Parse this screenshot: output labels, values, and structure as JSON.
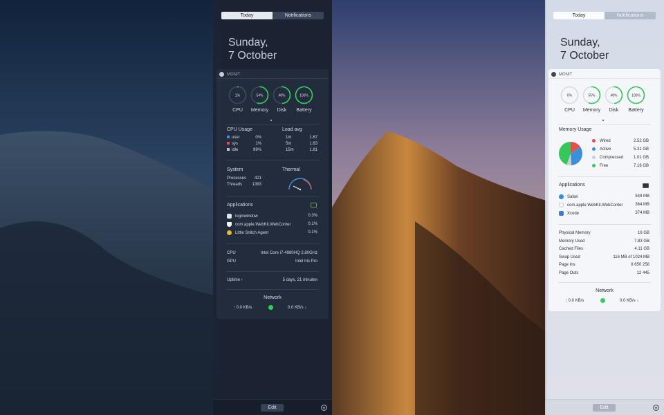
{
  "dark": {
    "tabs": {
      "today": "Today",
      "notifications": "Notifications"
    },
    "date": {
      "line1": "Sunday,",
      "line2": "7 October"
    },
    "widget_title": "MONIT",
    "gauges": [
      {
        "label": "CPU",
        "value": "1%",
        "fraction": 0.01
      },
      {
        "label": "Memory",
        "value": "54%",
        "fraction": 0.54
      },
      {
        "label": "Disk",
        "value": "48%",
        "fraction": 0.48
      },
      {
        "label": "Battery",
        "value": "100%",
        "fraction": 1.0
      }
    ],
    "cpu_usage": {
      "title": "CPU Usage",
      "rows": [
        {
          "label": "user",
          "value": "0%",
          "color": "#3b8fd9"
        },
        {
          "label": "sys",
          "value": "1%",
          "color": "#e2514a"
        },
        {
          "label": "idle",
          "value": "99%",
          "color": "#b9c0cc"
        }
      ]
    },
    "load_avg": {
      "title": "Load avg",
      "rows": [
        {
          "label": "1m",
          "value": "1.67"
        },
        {
          "label": "5m",
          "value": "1.63"
        },
        {
          "label": "15m",
          "value": "1.81"
        }
      ]
    },
    "system": {
      "title": "System",
      "rows": [
        {
          "label": "Processes",
          "value": "421"
        },
        {
          "label": "Threads",
          "value": "1393"
        }
      ]
    },
    "thermal": {
      "title": "Thermal"
    },
    "applications": {
      "title": "Applications",
      "rows": [
        {
          "name": "loginwindow",
          "value": "0.3%",
          "icon": "document-icon"
        },
        {
          "name": "com.apple.WebKit.WebConter",
          "value": "0.1%",
          "icon": "shield-icon"
        },
        {
          "name": "Little Snitch Agent",
          "value": "0.1%",
          "icon": "snitch-icon"
        }
      ]
    },
    "hardware": {
      "rows": [
        {
          "label": "CPU",
          "value": "Intel Core i7-4980HQ 2.80GHz"
        },
        {
          "label": "GPU",
          "value": "Intel Iris Pro"
        }
      ]
    },
    "uptime": {
      "label": "Uptime ›",
      "value": "5 days, 21 minutes"
    },
    "network": {
      "title": "Network",
      "up": "↑ 0.0 KB/s",
      "down": "0.0 KB/s ↓"
    },
    "edit": "Edit"
  },
  "light": {
    "tabs": {
      "today": "Today",
      "notifications": "Notifications"
    },
    "date": {
      "line1": "Sunday,",
      "line2": "7 October"
    },
    "widget_title": "MONIT",
    "gauges": [
      {
        "label": "CPU",
        "value": "0%",
        "fraction": 0.0
      },
      {
        "label": "Memory",
        "value": "55%",
        "fraction": 0.55
      },
      {
        "label": "Disk",
        "value": "48%",
        "fraction": 0.48
      },
      {
        "label": "Battery",
        "value": "100%",
        "fraction": 1.0
      }
    ],
    "memory_usage": {
      "title": "Memory Usage",
      "rows": [
        {
          "label": "Wired",
          "value": "2.52 GB",
          "color": "#e2514a"
        },
        {
          "label": "Active",
          "value": "5.31 GB",
          "color": "#3b8fd9"
        },
        {
          "label": "Compressed",
          "value": "1.01 GB",
          "color": "#c9ced6"
        },
        {
          "label": "Free",
          "value": "7.16 GB",
          "color": "#34c759"
        }
      ]
    },
    "applications": {
      "title": "Applications",
      "rows": [
        {
          "name": "Safari",
          "value": "549 MB",
          "icon": "safari-icon"
        },
        {
          "name": "com.apple.WebKit.WebConter",
          "value": "364 MB",
          "icon": "shield-icon"
        },
        {
          "name": "Xcode",
          "value": "374 MB",
          "icon": "xcode-icon"
        }
      ]
    },
    "memory_stats": {
      "rows": [
        {
          "label": "Physical Memory",
          "value": "16 GB"
        },
        {
          "label": "Memory Used",
          "value": "7.83 GB"
        },
        {
          "label": "Cached Files",
          "value": "4.11 GB"
        },
        {
          "label": "Swap Used",
          "value": "116 MB of 1024 MB"
        },
        {
          "label": "Page Ins",
          "value": "8 650 258"
        },
        {
          "label": "Page Outs",
          "value": "12 445"
        }
      ]
    },
    "network": {
      "title": "Network",
      "up": "↑ 0.0 KB/s",
      "down": "0.0 KB/s ↓"
    },
    "edit": "Edit"
  }
}
